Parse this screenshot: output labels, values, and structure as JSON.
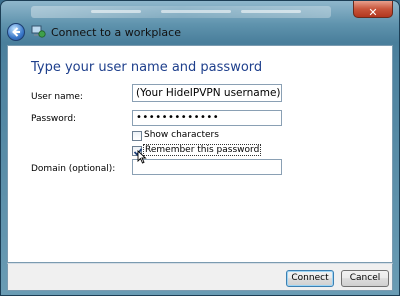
{
  "window": {
    "title": "Connect to a workplace",
    "close_glyph": "✕"
  },
  "icons": {
    "back": "back-arrow-icon",
    "network": "network-connection-icon"
  },
  "form": {
    "heading": "Type your user name and password",
    "username_label": "User name:",
    "username_value": "(Your HideIPVPN username)",
    "password_label": "Password:",
    "password_value": "•••••••••••••",
    "show_characters_label": "Show characters",
    "show_characters_checked": false,
    "remember_password_label": "Remember this password",
    "remember_password_checked": true,
    "domain_label": "Domain (optional):",
    "domain_value": ""
  },
  "buttons": {
    "connect": "Connect",
    "cancel": "Cancel"
  },
  "colors": {
    "heading": "#1e3f8c",
    "close": "#c8553b",
    "frame": "#5f93ad"
  }
}
